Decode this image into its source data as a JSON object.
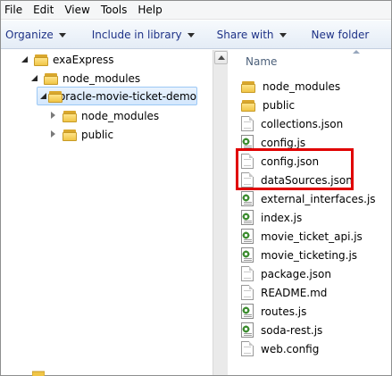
{
  "menubar": {
    "items": [
      "File",
      "Edit",
      "View",
      "Tools",
      "Help"
    ]
  },
  "toolbar": {
    "organize": "Organize",
    "include_in_library": "Include in library",
    "share_with": "Share with",
    "new_folder": "New folder"
  },
  "nav_tree": {
    "items": [
      {
        "label": "exaExpress",
        "expanded": true
      },
      {
        "label": "node_modules",
        "expanded": true
      },
      {
        "label": "oracle-movie-ticket-demo",
        "expanded": true,
        "selected": true
      },
      {
        "label": "node_modules",
        "expanded": false
      },
      {
        "label": "public",
        "expanded": false
      }
    ]
  },
  "content": {
    "column_header": "Name",
    "files": [
      {
        "label": "node_modules",
        "icon": "folder-icon"
      },
      {
        "label": "public",
        "icon": "folder-icon"
      },
      {
        "label": "collections.json",
        "icon": "document-icon"
      },
      {
        "label": "config.js",
        "icon": "script-file-icon"
      },
      {
        "label": "config.json",
        "icon": "document-icon"
      },
      {
        "label": "dataSources.json",
        "icon": "document-icon"
      },
      {
        "label": "external_interfaces.js",
        "icon": "script-file-icon"
      },
      {
        "label": "index.js",
        "icon": "script-file-icon"
      },
      {
        "label": "movie_ticket_api.js",
        "icon": "script-file-icon"
      },
      {
        "label": "movie_ticketing.js",
        "icon": "script-file-icon"
      },
      {
        "label": "package.json",
        "icon": "document-icon"
      },
      {
        "label": "README.md",
        "icon": "document-icon"
      },
      {
        "label": "routes.js",
        "icon": "script-file-icon"
      },
      {
        "label": "soda-rest.js",
        "icon": "script-file-icon"
      },
      {
        "label": "web.config",
        "icon": "document-icon"
      }
    ]
  },
  "colors": {
    "highlight": "#e00000",
    "toolbar_text": "#1e3287",
    "selection_border": "#9cc8f5"
  }
}
